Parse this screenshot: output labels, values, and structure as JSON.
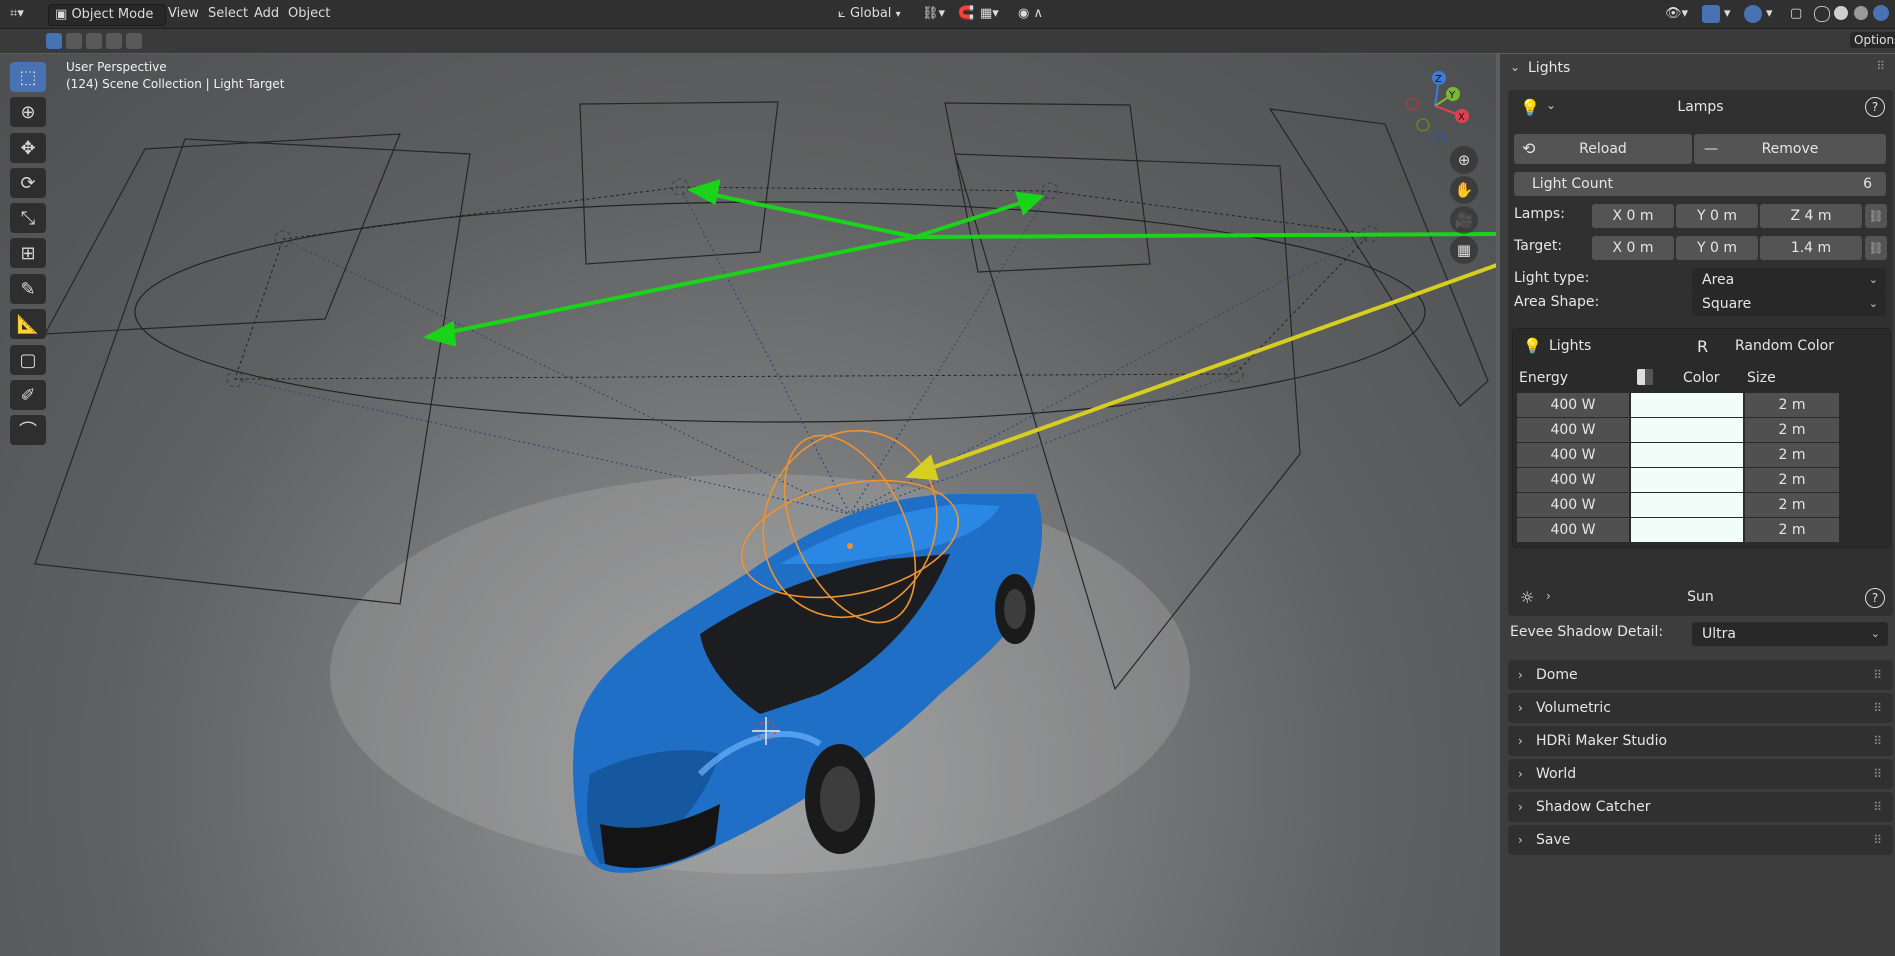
{
  "header": {
    "mode": "Object Mode",
    "menus": [
      "View",
      "Select",
      "Add",
      "Object"
    ],
    "orientation": "Global",
    "options": "Options"
  },
  "viewport": {
    "perspective": "User Perspective",
    "collection": "(124) Scene Collection | Light Target",
    "gizmo_axes": [
      "Z",
      "Y",
      "X"
    ]
  },
  "panel": {
    "title": "Lights",
    "lamps": {
      "title": "Lamps",
      "reload_label": "Reload",
      "remove_label": "Remove",
      "light_count_label": "Light Count",
      "light_count_value": "6",
      "lamps_label": "Lamps:",
      "lamps_x": "X  0 m",
      "lamps_y": "Y  0 m",
      "lamps_z": "Z  4 m",
      "target_label": "Target:",
      "target_x": "X  0 m",
      "target_y": "Y  0 m",
      "target_z": "1.4 m",
      "light_type_label": "Light type:",
      "light_type_value": "Area",
      "area_shape_label": "Area Shape:",
      "area_shape_value": "Square"
    },
    "lights_list": {
      "title": "Lights",
      "random_key": "R",
      "random_label": "Random Color",
      "col_energy": "Energy",
      "col_color": "Color",
      "col_size": "Size",
      "rows": [
        {
          "energy": "400 W",
          "size": "2 m"
        },
        {
          "energy": "400 W",
          "size": "2 m"
        },
        {
          "energy": "400 W",
          "size": "2 m"
        },
        {
          "energy": "400 W",
          "size": "2 m"
        },
        {
          "energy": "400 W",
          "size": "2 m"
        },
        {
          "energy": "400 W",
          "size": "2 m"
        }
      ]
    },
    "sun": {
      "title": "Sun"
    },
    "shadow_detail_label": "Eevee Shadow Detail:",
    "shadow_detail_value": "Ultra",
    "sections": [
      "Dome",
      "Volumetric",
      "HDRi Maker Studio",
      "World",
      "Shadow Catcher",
      "Save"
    ]
  },
  "colors": {
    "accent": "#4772b3",
    "arrow_green": "#19d419",
    "arrow_yellow": "#d6cf22",
    "car_blue": "#1f6fc6",
    "light_orange": "#f0922e"
  }
}
